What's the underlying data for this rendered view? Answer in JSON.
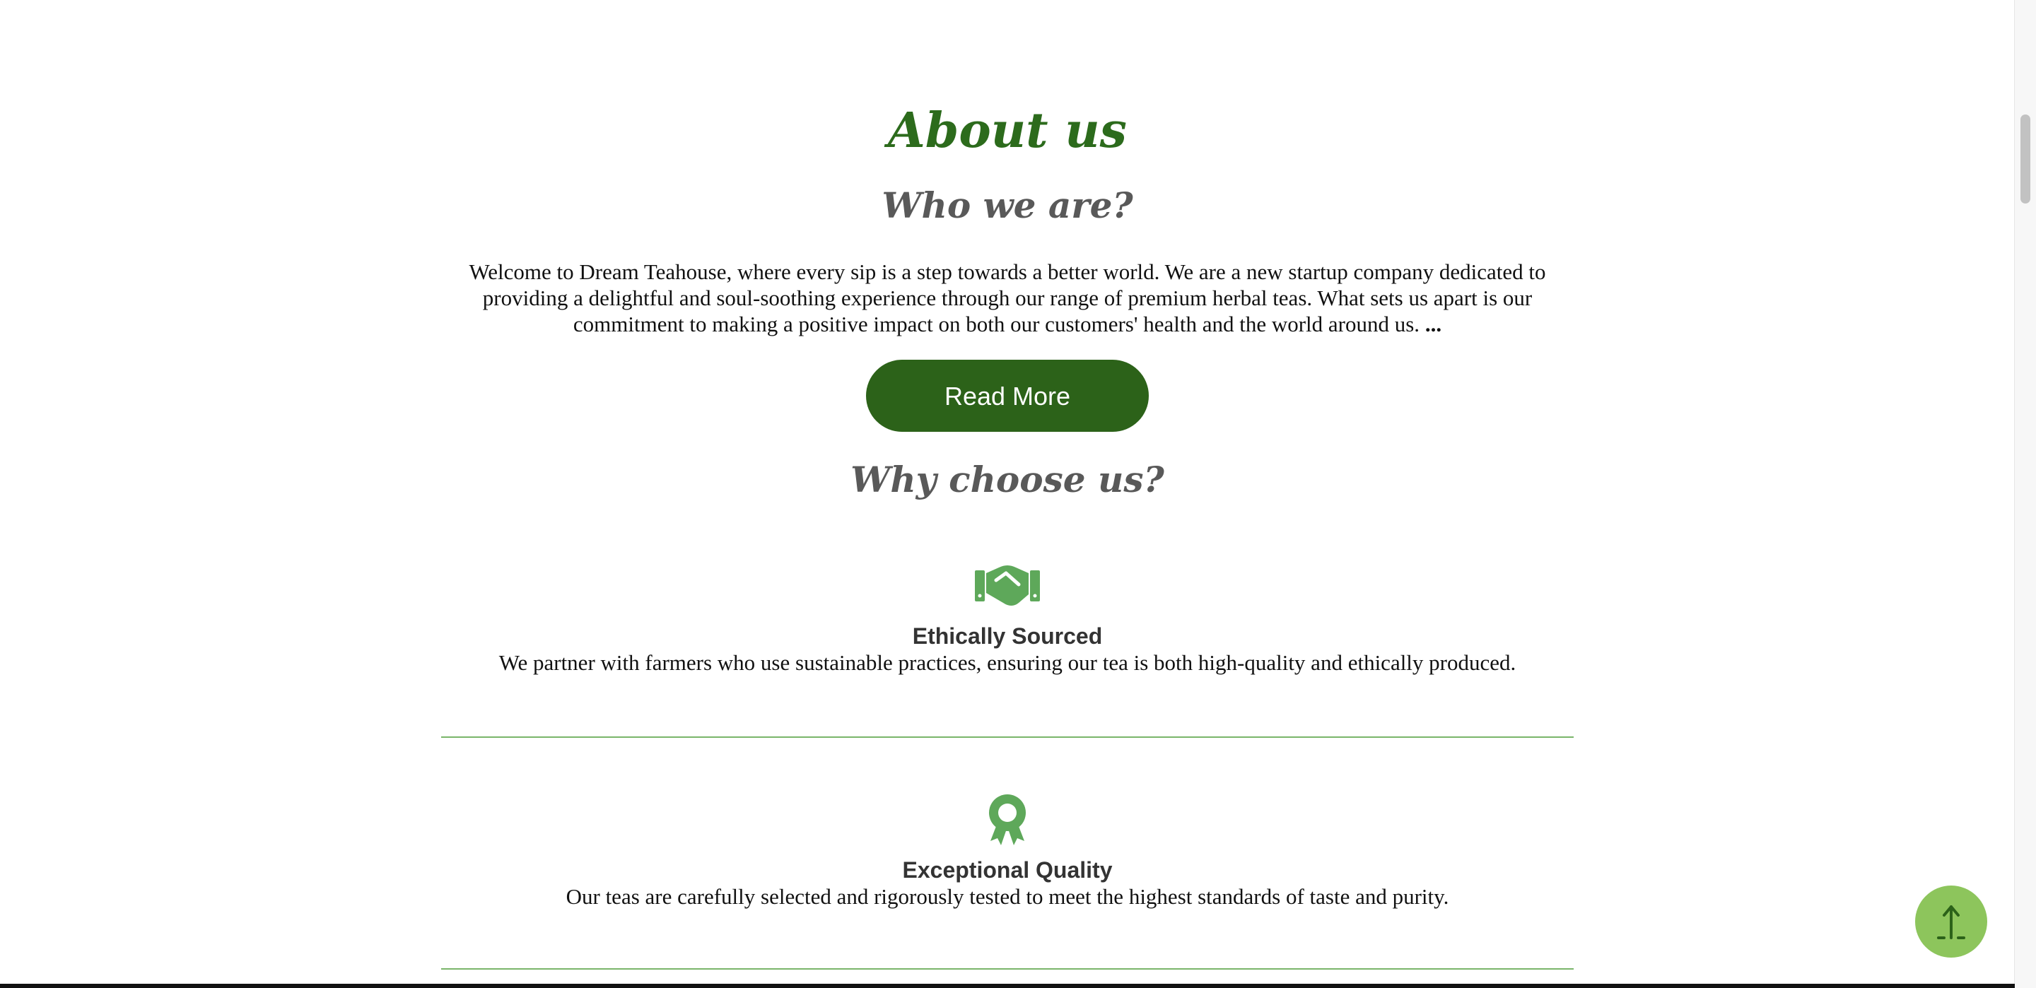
{
  "about": {
    "title": "About us",
    "who_title": "Who we are?",
    "welcome_text": "Welcome to Dream Teahouse, where every sip is a step towards a better world. We are a new startup company dedicated to providing a delightful and soul-soothing experience through our range of premium herbal teas. What sets us apart is our commitment to making a positive impact on both our customers' health and the world around us.",
    "ellipsis": "...",
    "read_more_label": "Read More"
  },
  "why": {
    "title": "Why choose us?",
    "features": [
      {
        "icon": "handshake-icon",
        "title": "Ethically Sourced",
        "description": "We partner with farmers who use sustainable practices, ensuring our tea is both high-quality and ethically produced."
      },
      {
        "icon": "award-ribbon-icon",
        "title": "Exceptional Quality",
        "description": "Our teas are carefully selected and rigorously tested to meet the highest standards of taste and purity."
      }
    ]
  },
  "back_to_top": {
    "icon": "arrow-up-icon"
  },
  "colors": {
    "brand_green": "#2c6219",
    "heading_green": "#2c6b1c",
    "icon_green": "#5ea85a",
    "divider_green": "#7ab56a",
    "back_to_top_bg": "#8dc55c"
  }
}
